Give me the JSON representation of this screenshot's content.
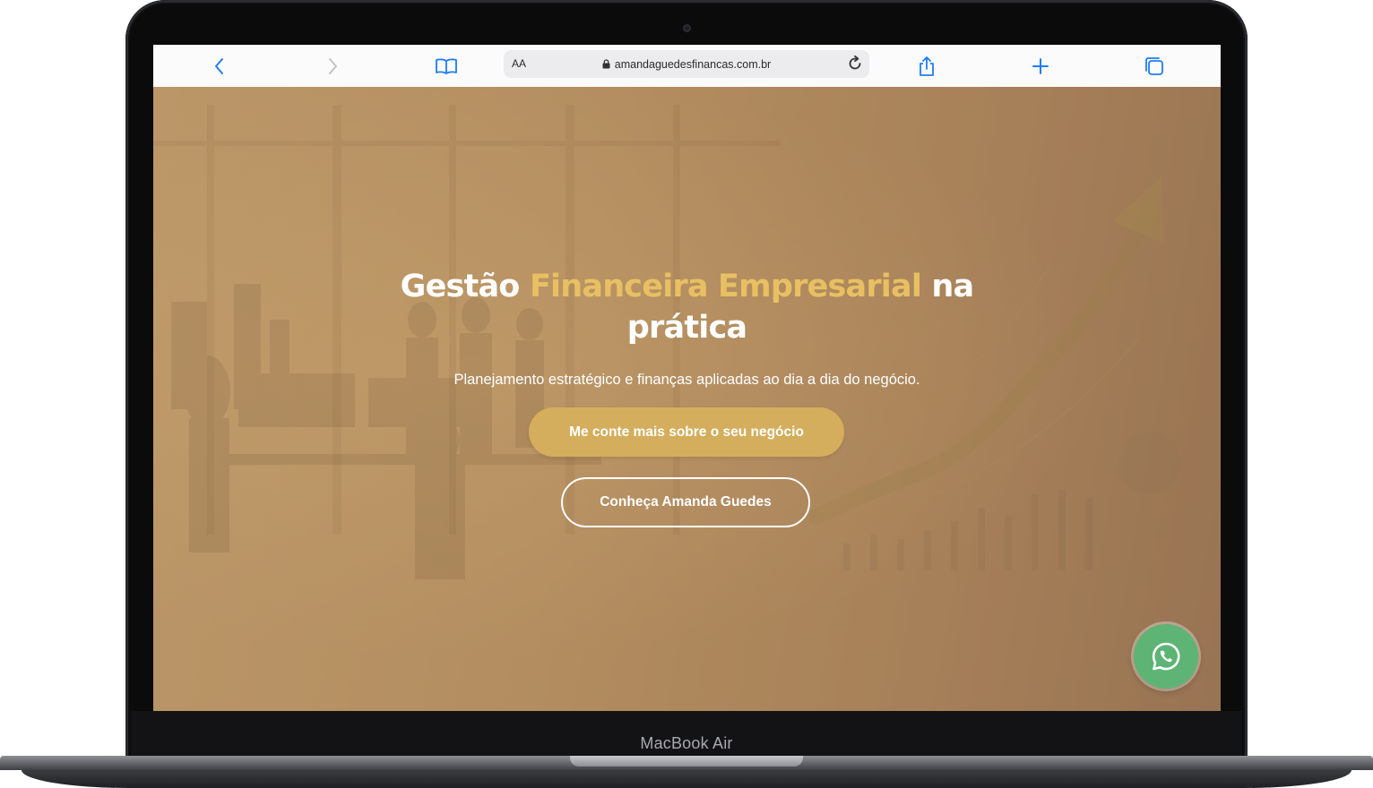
{
  "device": {
    "brand_label": "MacBook Air"
  },
  "browser": {
    "text_size_label": "AA",
    "url": "amandaguedesfinancas.com.br",
    "icons": [
      "back-icon",
      "forward-icon",
      "bookmarks-icon",
      "lock-icon",
      "reload-icon",
      "share-icon",
      "new-tab-icon",
      "tabs-icon"
    ]
  },
  "hero": {
    "title_part1": "Gestão",
    "title_highlight": "Financeira Empresarial",
    "title_part2": "na",
    "title_line2": "prática",
    "subtitle": "Planejamento estratégico e finanças aplicadas ao dia a dia do negócio.",
    "primary_cta": "Me conte mais sobre o seu negócio",
    "secondary_cta": "Conheça Amanda Guedes"
  },
  "floating": {
    "whatsapp_icon": "whatsapp-icon"
  },
  "colors": {
    "accent_gold": "#e8c063",
    "button_gold": "#d4ae5c",
    "whatsapp_green": "#5eb474",
    "ios_blue": "#1f7cf2"
  }
}
